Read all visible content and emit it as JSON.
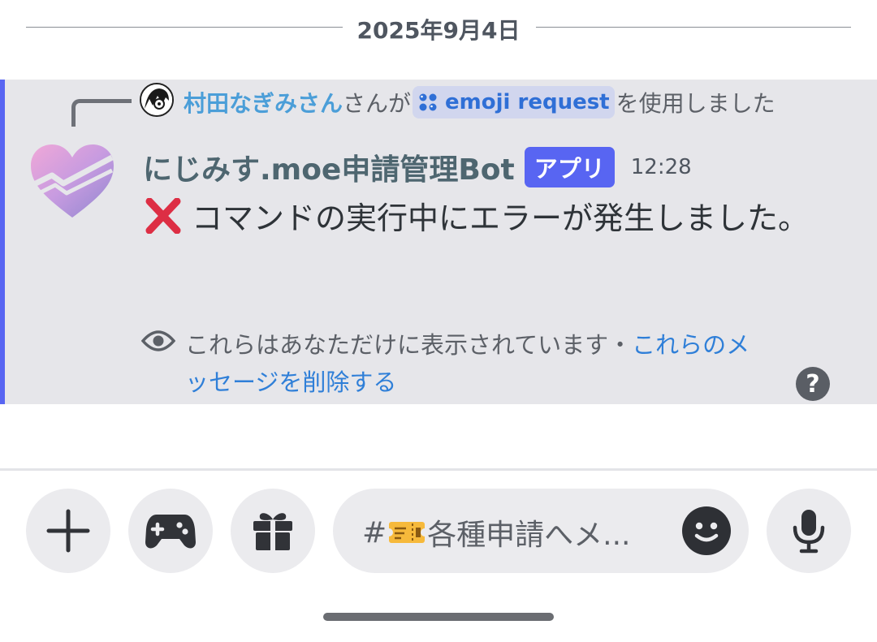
{
  "date_divider": "2025年9月4日",
  "reply": {
    "user": "村田なぎみさん",
    "used_prefix": "さんが",
    "command": "emoji request",
    "used_suffix": "を使用しました"
  },
  "message": {
    "bot_name": "にじみす.moe申請管理Bot",
    "badge": "アプリ",
    "time": "12:28",
    "text": "コマンドの実行中にエラーが発生しました。",
    "ephemeral_notice": "これらはあなただけに表示されています・",
    "dismiss_link": "これらのメッセージを削除する",
    "help": "?"
  },
  "composer": {
    "placeholder_hash": "#",
    "placeholder_text": "各種申請へメ..."
  },
  "colors": {
    "accent": "#5865f2",
    "link": "#2f7fd8",
    "error": "#dd2e44"
  },
  "icons": [
    "plus-icon",
    "gamepad-icon",
    "gift-icon",
    "emoji-icon",
    "microphone-icon",
    "eye-icon",
    "help-icon",
    "cross-mark-icon",
    "ticket-icon"
  ]
}
